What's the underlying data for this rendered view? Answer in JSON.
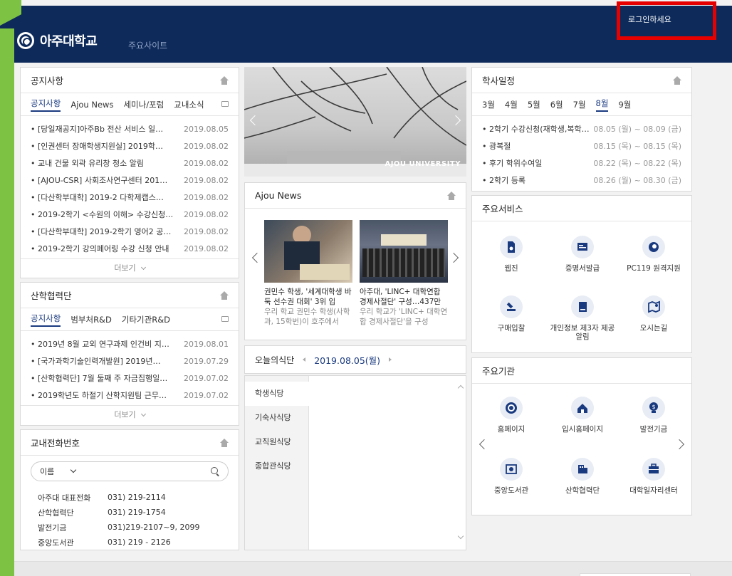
{
  "header": {
    "university_name": "아주대학교",
    "main_sites": "주요사이트",
    "login_link": "로그인하세요"
  },
  "notice": {
    "title": "공지사항",
    "tabs": [
      "공지사항",
      "Ajou News",
      "세미나/포럼",
      "교내소식"
    ],
    "items": [
      {
        "title": "• [당일재공지]아주Bb 전산 서비스 일…",
        "date": "2019.08.05"
      },
      {
        "title": "• [인권센터 장애학생지원실] 2019학…",
        "date": "2019.08.02"
      },
      {
        "title": "• 교내 건물 외곽 유리창 청소 알림",
        "date": "2019.08.02"
      },
      {
        "title": "• [AJOU-CSR] 사회조사연구센터 201…",
        "date": "2019.08.02"
      },
      {
        "title": "• [다산학부대학] 2019-2 다학제캡스…",
        "date": "2019.08.02"
      },
      {
        "title": "• 2019-2학기 <수원의 이해> 수강신청…",
        "date": "2019.08.02"
      },
      {
        "title": "• [다산학부대학] 2019-2학기 영어2 공…",
        "date": "2019.08.02"
      },
      {
        "title": "• 2019-2학기 강의페어링 수강 신청 안내",
        "date": "2019.08.02"
      }
    ],
    "more": "더보기"
  },
  "industry": {
    "title": "산학협력단",
    "tabs": [
      "공지사항",
      "범부처R&D",
      "기타기관R&D"
    ],
    "items": [
      {
        "title": "• 2019년 8월 교외 연구과제 인건비 지…",
        "date": "2019.08.01"
      },
      {
        "title": "• [국가과학기술인력개발원] 2019년…",
        "date": "2019.07.29"
      },
      {
        "title": "• [산학협력단] 7월 둘째 주 자금집행일…",
        "date": "2019.07.02"
      },
      {
        "title": "• 2019학년도 하절기 산학지원팀 근무…",
        "date": "2019.07.02"
      }
    ],
    "more": "더보기"
  },
  "phonebook": {
    "title": "교내전화번호",
    "search_select": "이름",
    "entries": [
      {
        "name": "아주대 대표전화",
        "number": "031) 219-2114"
      },
      {
        "name": "산학협력단",
        "number": "031) 219-1754"
      },
      {
        "name": "발전기금",
        "number": "031)219-2107~9, 2099"
      },
      {
        "name": "중앙도서관",
        "number": "031) 219 - 2126"
      }
    ]
  },
  "banner": {
    "brand_text": "AJOU UNIVERSITY"
  },
  "ajou_news": {
    "title": "Ajou News",
    "cards": [
      {
        "headline": "권민수 학생, '세계대학생 바둑 선수권 대회' 3위 입",
        "summary": "우리 학교 권민수 학생(사학과, 15학번)이 호주에서"
      },
      {
        "headline": "아주대, 'LINC+ 대학연합 경제사절단' 구성…437만",
        "summary": "우리 학교가 'LINC+ 대학연합 경제사절단'을 구성"
      }
    ]
  },
  "meal": {
    "label": "오늘의식단",
    "date": "2019.08.05(월)",
    "places": [
      "학생식당",
      "기숙사식당",
      "교직원식당",
      "종합관식당"
    ]
  },
  "calendar": {
    "title": "학사일정",
    "months": [
      "3월",
      "4월",
      "5월",
      "6월",
      "7월",
      "8월",
      "9월"
    ],
    "active_month": "8월",
    "events": [
      {
        "title": "• 2학기 수강신청(재학생,복학…",
        "date": "08.05 (월) ~ 08.09 (금)"
      },
      {
        "title": "• 광복절",
        "date": "08.15 (목) ~ 08.15 (목)"
      },
      {
        "title": "• 후기 학위수여일",
        "date": "08.22 (목) ~ 08.22 (목)"
      },
      {
        "title": "• 2학기 등록",
        "date": "08.26 (월) ~ 08.30 (금)"
      }
    ]
  },
  "services": {
    "title": "주요서비스",
    "items": [
      {
        "label": "웹진",
        "icon": "webzine-icon"
      },
      {
        "label": "증명서발급",
        "icon": "certificate-icon"
      },
      {
        "label": "PC119 원격지원",
        "icon": "remote-support-icon"
      },
      {
        "label": "구매입찰",
        "icon": "gavel-icon"
      },
      {
        "label": "개인정보 제3자 제공 알림",
        "icon": "document-icon"
      },
      {
        "label": "오시는길",
        "icon": "map-icon"
      }
    ]
  },
  "institutions": {
    "title": "주요기관",
    "items": [
      {
        "label": "홈페이지",
        "icon": "university-seal-icon"
      },
      {
        "label": "입시홈페이지",
        "icon": "admission-home-icon"
      },
      {
        "label": "발전기금",
        "icon": "fund-bulb-icon"
      },
      {
        "label": "중앙도서관",
        "icon": "library-icon"
      },
      {
        "label": "산학협력단",
        "icon": "building-icon"
      },
      {
        "label": "대학일자리센터",
        "icon": "briefcase-icon"
      }
    ]
  },
  "colors": {
    "navy": "#0d2a5a",
    "accent_green": "#7dc242",
    "highlight_red": "#e60000",
    "icon_blue": "#1a3a80"
  }
}
